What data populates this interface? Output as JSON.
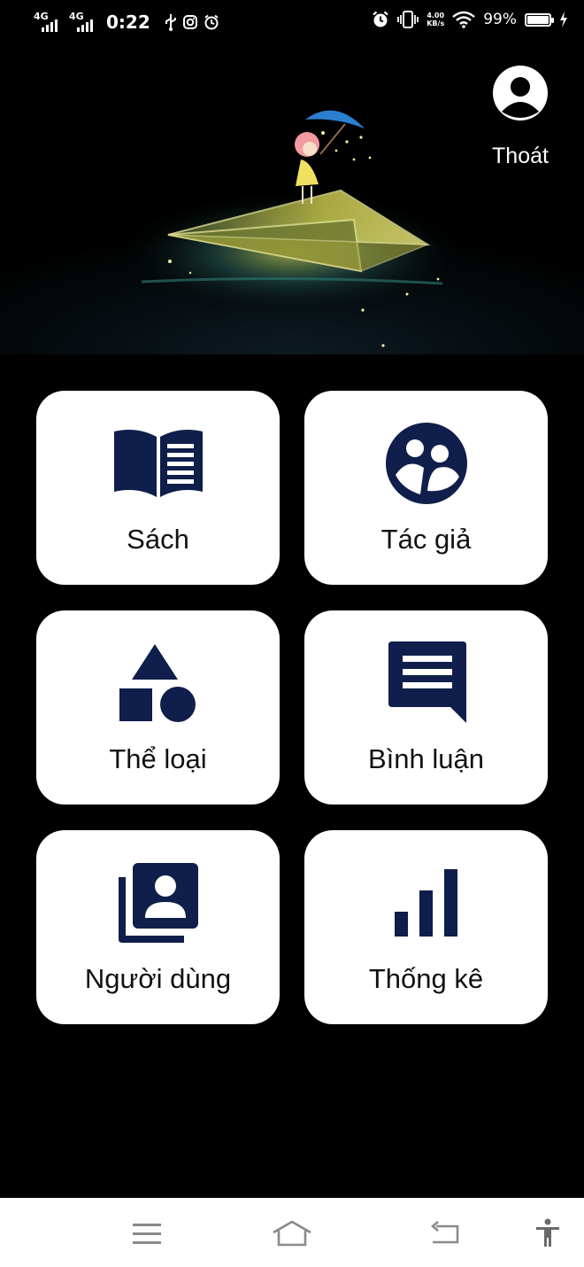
{
  "status_bar": {
    "network_1": "4G",
    "network_2": "4G",
    "time": "0:22",
    "speed_value": "4.00",
    "speed_unit": "KB/s",
    "battery_percent": "99%",
    "battery_level": 0.99
  },
  "header": {
    "logout_label": "Thoát"
  },
  "menu": {
    "items": [
      {
        "label": "Sách",
        "icon": "book-icon"
      },
      {
        "label": "Tác giả",
        "icon": "authors-icon"
      },
      {
        "label": "Thể loại",
        "icon": "category-shapes-icon"
      },
      {
        "label": "Bình luận",
        "icon": "comment-icon"
      },
      {
        "label": "Người dùng",
        "icon": "users-icon"
      },
      {
        "label": "Thống kê",
        "icon": "bar-chart-icon"
      }
    ]
  },
  "colors": {
    "background": "#000000",
    "card": "#ffffff",
    "icon": "#0f1e4a",
    "nav_icon": "#8a8a8a"
  }
}
